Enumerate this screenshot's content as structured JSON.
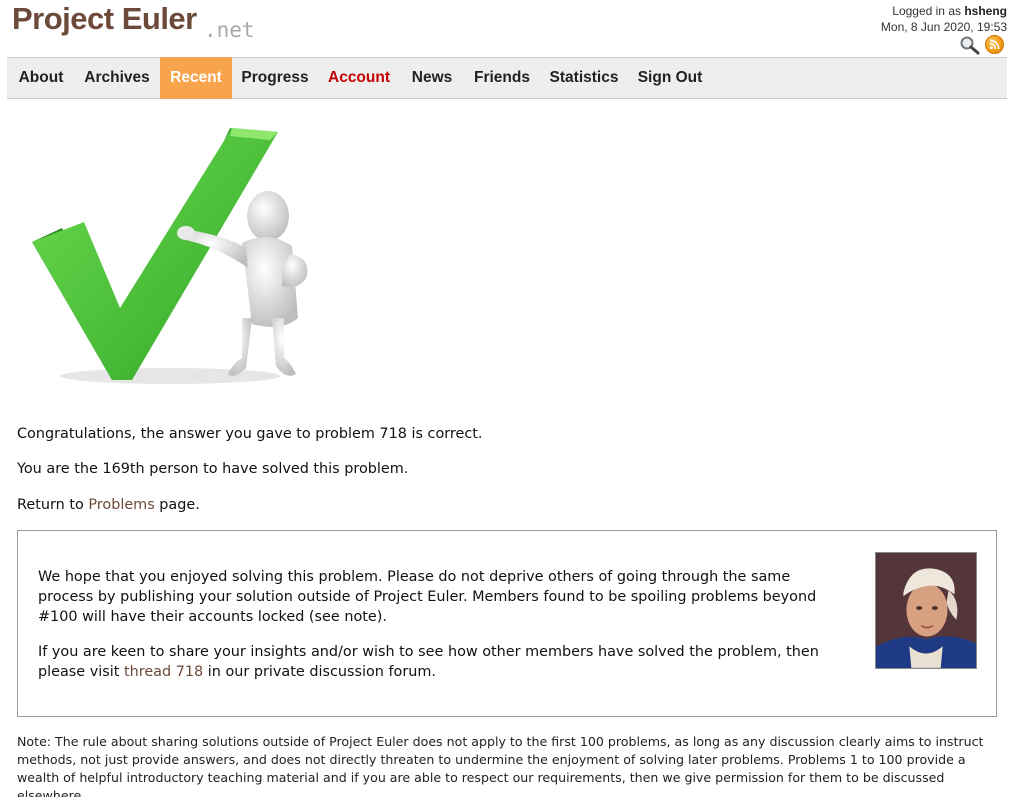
{
  "header": {
    "logo": "Project Euler",
    "logo_suffix": ".net",
    "logged_in_prefix": "Logged in as ",
    "username": "hsheng",
    "datetime": "Mon, 8 Jun 2020, 19:53"
  },
  "nav": {
    "items": [
      {
        "label": "About"
      },
      {
        "label": "Archives"
      },
      {
        "label": "Recent"
      },
      {
        "label": "Progress"
      },
      {
        "label": "Account"
      },
      {
        "label": "News"
      },
      {
        "label": "Friends"
      },
      {
        "label": "Statistics"
      },
      {
        "label": "Sign Out"
      }
    ],
    "active": "Recent",
    "colors": {
      "active_bg": "#f8a44d",
      "account_text": "#c40000"
    }
  },
  "main": {
    "congrats": "Congratulations, the answer you gave to problem 718 is correct.",
    "solver_rank": "You are the 169th person to have solved this problem.",
    "return_prefix": "Return to ",
    "return_link": "Problems",
    "return_suffix": " page."
  },
  "notice": {
    "para1": "We hope that you enjoyed solving this problem. Please do not deprive others of going through the same process by publishing your solution outside of Project Euler. Members found to be spoiling problems beyond #100 will have their accounts locked (see note).",
    "para2_prefix": "If you are keen to share your insights and/or wish to see how other members have solved the problem, then please visit ",
    "thread_link": "thread 718",
    "para2_suffix": " in our private discussion forum."
  },
  "note": "Note: The rule about sharing solutions outside of Project Euler does not apply to the first 100 problems, as long as any discussion clearly aims to instruct methods, not just provide answers, and does not directly threaten to undermine the enjoyment of solving later problems. Problems 1 to 100 provide a wealth of helpful introductory teaching material and if you are able to respect our requirements, then we give permission for them to be discussed elsewhere.",
  "icons": [
    "search-icon",
    "rss-icon",
    "checkmark-icon",
    "portrait-image"
  ]
}
